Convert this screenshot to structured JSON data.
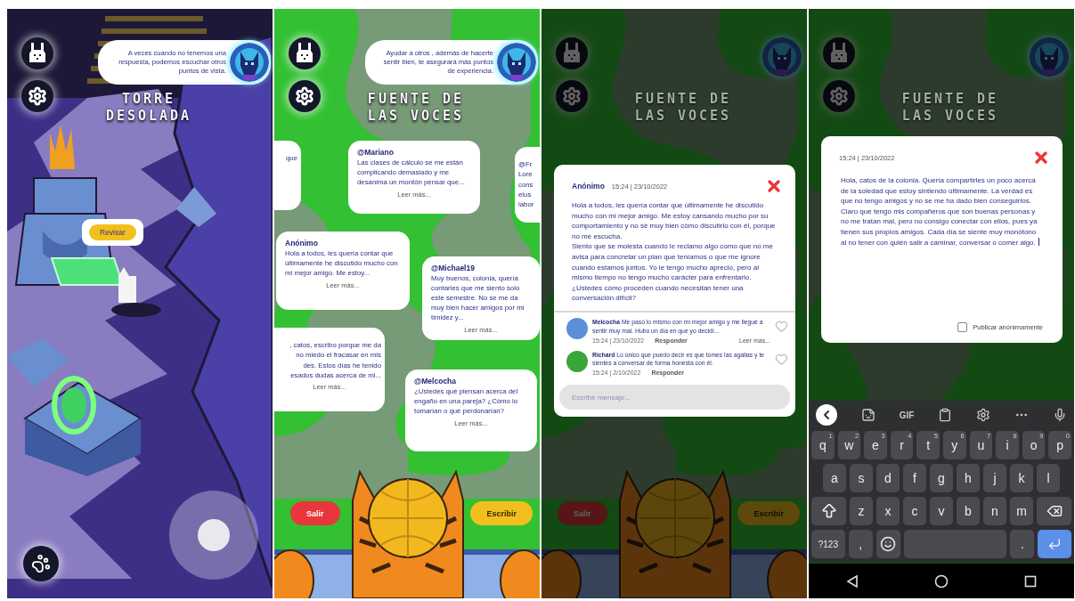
{
  "screens": [
    {
      "kind": "map",
      "title": [
        "TORRE",
        "DESOLADA"
      ],
      "hint": "A veces cuando no tenemos una respuesta, podemos escuchar otros puntos de vista.",
      "action": "Revisar"
    },
    {
      "kind": "board",
      "title": [
        "FUENTE DE",
        "LAS VOCES"
      ],
      "hint": "Ayudar a otros , además de hacerte sentir bien, te asegurará más puntos de experiencia.",
      "cards": [
        {
          "kind": "cut-left",
          "lines": [
            "que"
          ]
        },
        {
          "kind": "full",
          "author": "@Mariano",
          "text": "Las clases de cálculo se me están complicando demasiado y me desanima un montón pensar que...",
          "more": "Leer más..."
        },
        {
          "kind": "cut-right",
          "lines": [
            "@Fr",
            "Lore",
            "cons",
            "eius",
            "labor"
          ]
        },
        {
          "kind": "full",
          "author": "Anónimo",
          "text": "Hola a todos, les quería contar que últimamente he discutido mucho con mi mejor amigo. Me estoy...",
          "more": "Leer más..."
        },
        {
          "kind": "full",
          "author": "@Michael19",
          "text": "Muy buenos, colonia, quería contarles que me siento solo este semestre. No se me da muy bien hacer amigos por mi timidez y...",
          "more": "Leer más..."
        },
        {
          "kind": "cut-left",
          "lines": [
            ", catos, escribo porque me da",
            "no miedo el fracasar en mis",
            "des. Estos días he tenido",
            "esados dudas acerca de mi..."
          ],
          "more": "Leer más..."
        },
        {
          "kind": "full",
          "author": "@Melcocha",
          "text": "¿Ustedes qué piensan acerca del engaño en una pareja? ¿Cómo lo tomarían o qué perdonarían?",
          "more": "Leer más..."
        }
      ],
      "buttons": [
        {
          "label": "Salir",
          "kind": "exit"
        },
        {
          "label": "Escribir",
          "kind": "write"
        }
      ]
    },
    {
      "kind": "post",
      "title": [
        "FUENTE DE",
        "LAS VOCES"
      ],
      "buttons": [
        {
          "label": "Salir",
          "kind": "exit"
        },
        {
          "label": "Escribir",
          "kind": "write"
        }
      ],
      "post": {
        "author": "Anónimo",
        "time": "15:24 | 23/10/2022",
        "body": "Hola a todos, les quería contar que últimamente he discutido mucho con mi mejor amigo. Me estoy cansando mucho por su comportamiento y no sé muy bien cómo discutirlo con él, porque no me escucha.\nSiento que se molesta cuando le reclamo algo como que no me avisa para concretar un plan que teníamos o que me ignore cuando estamos juntos. Yo le tengo mucho aprecio, pero al mismo tiempo no tengo mucho carácter para enfrentarlo. ¿Ustedes cómo proceden cuando necesitan tener una conversación difícil?",
        "comments": [
          {
            "author": "Melcocha",
            "color": "#5b8fd8",
            "text": "Me pasó lo mismo con mi mejor amigo y me llegué a sentir muy mal. Hubo un día en que yo decidí...",
            "time": "15:24 | 23/10/2022",
            "reply": "Responder",
            "more": "Leer más...",
            "liked": false
          },
          {
            "author": "Richard",
            "color": "#3aa63a",
            "text": "Lo único que puedo decir es que tomes las agallas y te sientes a conversar de forma honesta con él.",
            "time": "15:24 | 2/10/2022",
            "reply": "Responder",
            "liked": false
          }
        ],
        "input": {
          "placeholder": "Escribir mensaje..."
        }
      }
    },
    {
      "kind": "compose",
      "title": [
        "FUENTE DE",
        "LAS VOCES"
      ],
      "draft": {
        "time": "15:24 | 23/10/2022",
        "value": "Hola, catos de la colonia. Quería compartirles un poco acerca de la soledad que estoy sintiendo últimamente. La verdad es que no tengo amigos y no se me ha dado bien conseguirlos. Claro que tengo mis compañeros que son buenas personas y no me tratan mal, pero no consigo conectar con ellos, pues ya tienen sus propios amigos. Cada día se siente muy monótono al no tener con quién salir a caminar, conversar o comer algo.",
        "anonymous": {
          "label": "Publicar anónimamente",
          "checked": false
        }
      },
      "keyboard": {
        "toolbar_label": "GIF",
        "rows": [
          {
            "keys": [
              {
                "kind": "char",
                "label": "q",
                "sup": "1"
              },
              {
                "kind": "char",
                "label": "w",
                "sup": "2"
              },
              {
                "kind": "char",
                "label": "e",
                "sup": "3"
              },
              {
                "kind": "char",
                "label": "r",
                "sup": "4"
              },
              {
                "kind": "char",
                "label": "t",
                "sup": "5"
              },
              {
                "kind": "char",
                "label": "y",
                "sup": "6"
              },
              {
                "kind": "char",
                "label": "u",
                "sup": "7"
              },
              {
                "kind": "char",
                "label": "i",
                "sup": "8"
              },
              {
                "kind": "char",
                "label": "o",
                "sup": "9"
              },
              {
                "kind": "char",
                "label": "p",
                "sup": "0"
              }
            ]
          },
          {
            "keys": [
              {
                "kind": "char",
                "label": "a"
              },
              {
                "kind": "char",
                "label": "s"
              },
              {
                "kind": "char",
                "label": "d"
              },
              {
                "kind": "char",
                "label": "f"
              },
              {
                "kind": "char",
                "label": "g"
              },
              {
                "kind": "char",
                "label": "h"
              },
              {
                "kind": "char",
                "label": "j"
              },
              {
                "kind": "char",
                "label": "k"
              },
              {
                "kind": "char",
                "label": "l"
              }
            ]
          },
          {
            "keys": [
              {
                "kind": "shift"
              },
              {
                "kind": "char",
                "label": "z"
              },
              {
                "kind": "char",
                "label": "x"
              },
              {
                "kind": "char",
                "label": "c"
              },
              {
                "kind": "char",
                "label": "v"
              },
              {
                "kind": "char",
                "label": "b"
              },
              {
                "kind": "char",
                "label": "n"
              },
              {
                "kind": "char",
                "label": "m"
              },
              {
                "kind": "backspace"
              }
            ]
          },
          {
            "keys": [
              {
                "kind": "mode",
                "label": "?123"
              },
              {
                "kind": "char",
                "label": ","
              },
              {
                "kind": "emoji"
              },
              {
                "kind": "space"
              },
              {
                "kind": "char",
                "label": "."
              },
              {
                "kind": "enter"
              }
            ]
          }
        ]
      }
    }
  ]
}
